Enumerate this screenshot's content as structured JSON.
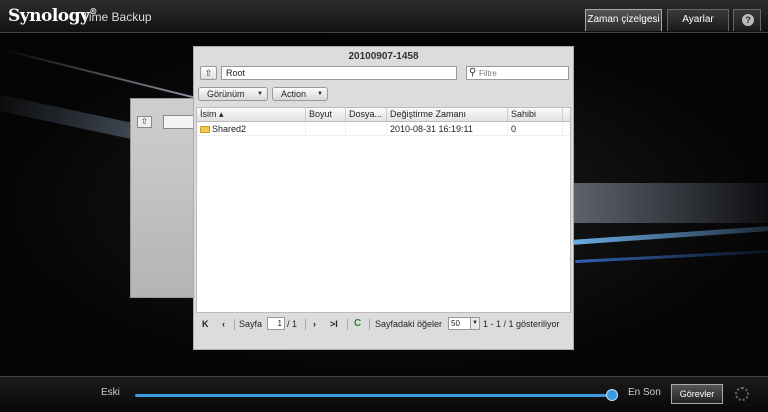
{
  "header": {
    "logo": "Synology",
    "app_title": "Time Backup",
    "tabs": [
      {
        "label": "Zaman çizelgesi",
        "active": true
      },
      {
        "label": "Ayarlar",
        "active": false
      }
    ],
    "help_icon": "help-icon"
  },
  "dialog": {
    "title": "20100907-1458",
    "path": "Root",
    "filter_placeholder": "Filtre",
    "toolbar": {
      "view_label": "Görünüm",
      "action_label": "Action"
    },
    "columns": [
      "İsim",
      "Boyut",
      "Dosya...",
      "Değiştirme Zamanı",
      "Sahibi"
    ],
    "rows": [
      {
        "name": "Shared2",
        "size": "",
        "type": "",
        "modified": "2010-08-31 16:19:11",
        "owner": "0",
        "icon": "folder-icon"
      }
    ],
    "pager": {
      "page_label": "Sayfa",
      "page_value": "1",
      "page_total": "/ 1",
      "items_per_page_label": "Sayfadaki öğeler",
      "items_per_page_value": "50",
      "display_text": "1 - 1 / 1 gösteriliyor"
    }
  },
  "timeline": {
    "left_label": "Eski",
    "right_label": "En Son",
    "tasks_label": "Görevler",
    "position": 1.0,
    "accent_color": "#3a9be0"
  }
}
